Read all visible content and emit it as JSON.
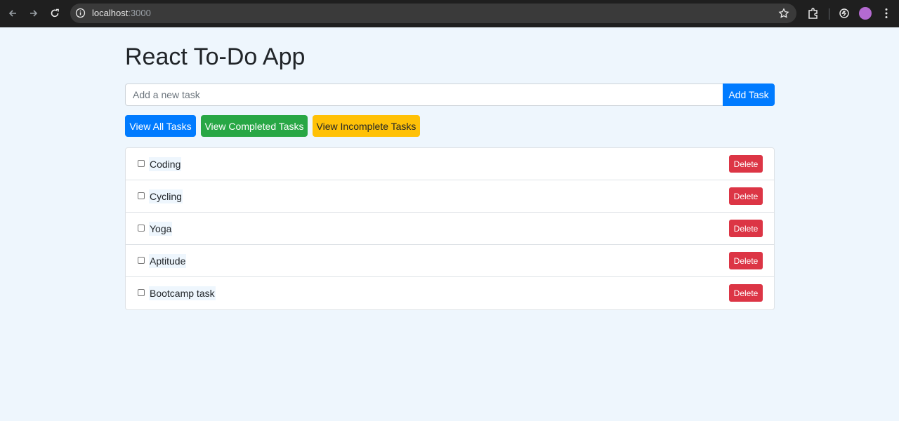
{
  "browser": {
    "url_host": "localhost",
    "url_port": ":3000"
  },
  "app": {
    "title": "React To-Do App"
  },
  "new_task": {
    "placeholder": "Add a new task",
    "value": "",
    "add_label": "Add Task"
  },
  "filters": {
    "all_label": "View All Tasks",
    "completed_label": "View Completed Tasks",
    "incomplete_label": "View Incomplete Tasks"
  },
  "tasks": [
    {
      "label": "Coding",
      "completed": false,
      "delete_label": "Delete"
    },
    {
      "label": "Cycling",
      "completed": false,
      "delete_label": "Delete"
    },
    {
      "label": "Yoga",
      "completed": false,
      "delete_label": "Delete"
    },
    {
      "label": "Aptitude",
      "completed": false,
      "delete_label": "Delete"
    },
    {
      "label": "Bootcamp task",
      "completed": false,
      "delete_label": "Delete"
    }
  ],
  "colors": {
    "primary": "#007bff",
    "success": "#28a745",
    "warning": "#ffc107",
    "danger": "#dc3545",
    "page_background": "#eef6fd"
  }
}
